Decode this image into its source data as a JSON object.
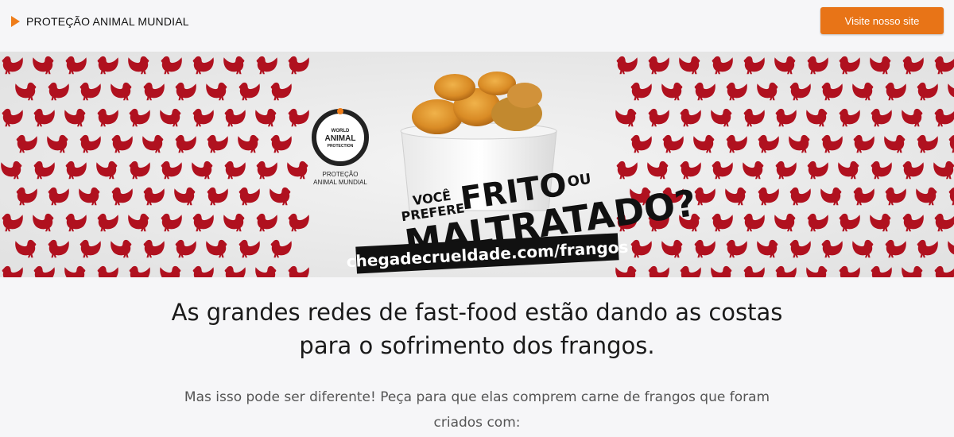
{
  "header": {
    "brand_name": "PROTEÇÃO ANIMAL MUNDIAL",
    "visit_button": "Visite nosso site"
  },
  "banner": {
    "logo_line1": "WORLD",
    "logo_line2": "ANIMAL",
    "logo_line3": "PROTECTION",
    "logo_sub1": "PROTEÇÃO",
    "logo_sub2": "ANIMAL MUNDIAL",
    "word_voce": "VOCÊ",
    "word_prefere": "PREFERE",
    "word_frito": "FRITO",
    "word_ou": "OU",
    "word_maltratado": "MALTRATADO?",
    "url": "chegadecrueldade.com/frangos",
    "chicken_color": "#b0111f"
  },
  "main": {
    "headline_line1": "As grandes redes de fast-food estão dando as costas",
    "headline_line2": "para o sofrimento dos frangos.",
    "sub_line1": "Mas isso pode ser diferente! Peça para que elas comprem carne de frangos que foram",
    "sub_line2": "criados com:"
  }
}
